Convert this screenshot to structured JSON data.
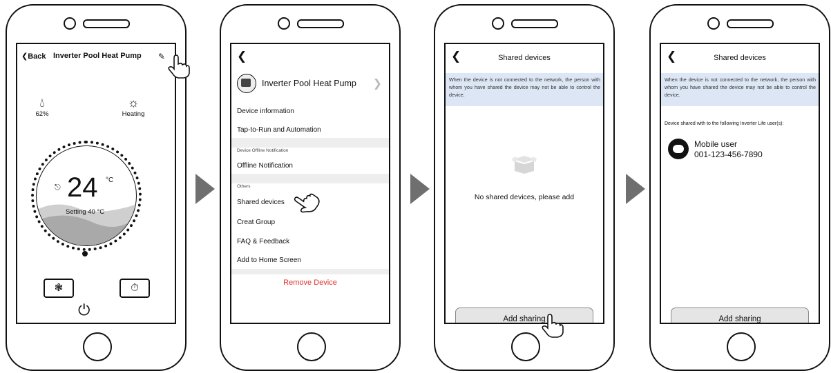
{
  "screen1": {
    "back_label": "Back",
    "title": "Inverter Pool Heat Pump",
    "edit_icon": "pencil-icon",
    "stat_left": {
      "icon": "water-drop-icon",
      "value": "62%"
    },
    "stat_right": {
      "icon": "sun-icon",
      "value": "Heating"
    },
    "temperature": "24",
    "unit": "°C",
    "setting": "Setting 40 °C",
    "fan_icon": "fan-icon",
    "timer_icon": "timer-icon",
    "power_icon": "power-icon"
  },
  "screen2": {
    "device_name": "Inverter Pool Heat Pump",
    "items_group1": [
      "Device information",
      "Tap-to-Run and Automation"
    ],
    "section_offline": "Device Offline Notification",
    "offline_item": "Offline Notification",
    "section_others": "Others",
    "items_group2": [
      "Shared devices",
      "Creat Group",
      "FAQ & Feedback",
      "Add to Home Screen"
    ],
    "remove_label": "Remove Device",
    "colors": {
      "remove": "#e0312b",
      "section_bg": "#eeeeee"
    }
  },
  "screen3": {
    "title": "Shared devices",
    "note": "When the device is not connected to the network, the person with whom you have shared the device may not be able to control the device.",
    "empty_text": "No shared devices, please add",
    "add_label": "Add sharing",
    "colors": {
      "note_bg": "#dde6f4"
    }
  },
  "screen4": {
    "title": "Shared devices",
    "note": "When the device is not connected to the network, the person with whom you have shared the device may not be able to control the device.",
    "shared_with": "Device shared with to the following Inverter Life user(s):",
    "user_name": "Mobile user",
    "user_phone": "001-123-456-7890",
    "add_label": "Add sharing"
  }
}
